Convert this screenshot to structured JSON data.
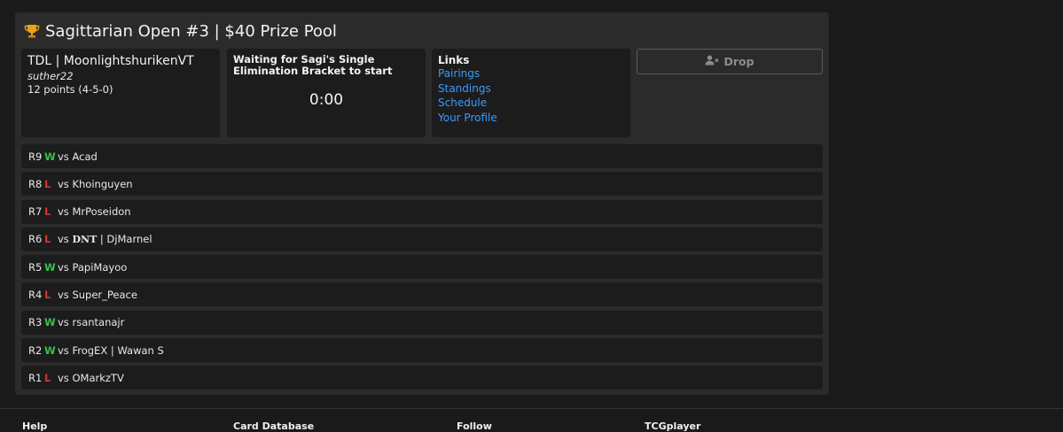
{
  "header": {
    "title": "Sagittarian Open #3 | $40 Prize Pool",
    "trophy_icon": "trophy-icon"
  },
  "player": {
    "name": "TDL | MoonlightshurikenVT",
    "username": "suther22",
    "points": "12 points (4-5-0)"
  },
  "status": {
    "message": "Waiting for Sagi's Single Elimination Bracket to start",
    "timer": "0:00"
  },
  "links": {
    "title": "Links",
    "items": [
      "Pairings",
      "Standings",
      "Schedule",
      "Your Profile"
    ]
  },
  "drop_button": {
    "label": "Drop",
    "icon": "user-remove-icon"
  },
  "rounds": [
    {
      "round": "R9",
      "result": "W",
      "vs": "vs",
      "opponent": "Acad"
    },
    {
      "round": "R8",
      "result": "L",
      "vs": "vs",
      "opponent": "Khoinguyen"
    },
    {
      "round": "R7",
      "result": "L",
      "vs": "vs",
      "opponent": "MrPoseidon"
    },
    {
      "round": "R6",
      "result": "L",
      "vs": "vs",
      "opponent_tag": "DNT",
      "opponent": "| DjMarnel"
    },
    {
      "round": "R5",
      "result": "W",
      "vs": "vs",
      "opponent": "PapiMayoo"
    },
    {
      "round": "R4",
      "result": "L",
      "vs": "vs",
      "opponent": "Super_Peace"
    },
    {
      "round": "R3",
      "result": "W",
      "vs": "vs",
      "opponent": "rsantanajr"
    },
    {
      "round": "R2",
      "result": "W",
      "vs": "vs",
      "opponent": "FrogEX | Wawan S"
    },
    {
      "round": "R1",
      "result": "L",
      "vs": "vs",
      "opponent": "OMarkzTV"
    }
  ],
  "footer": {
    "items": [
      "Help",
      "Card Database",
      "Follow",
      "TCGplayer"
    ]
  },
  "colors": {
    "win": "#35c24d",
    "loss": "#e0302c",
    "link": "#3a9bff",
    "panel": "#2b2b2b",
    "card": "#1c1c1c"
  }
}
